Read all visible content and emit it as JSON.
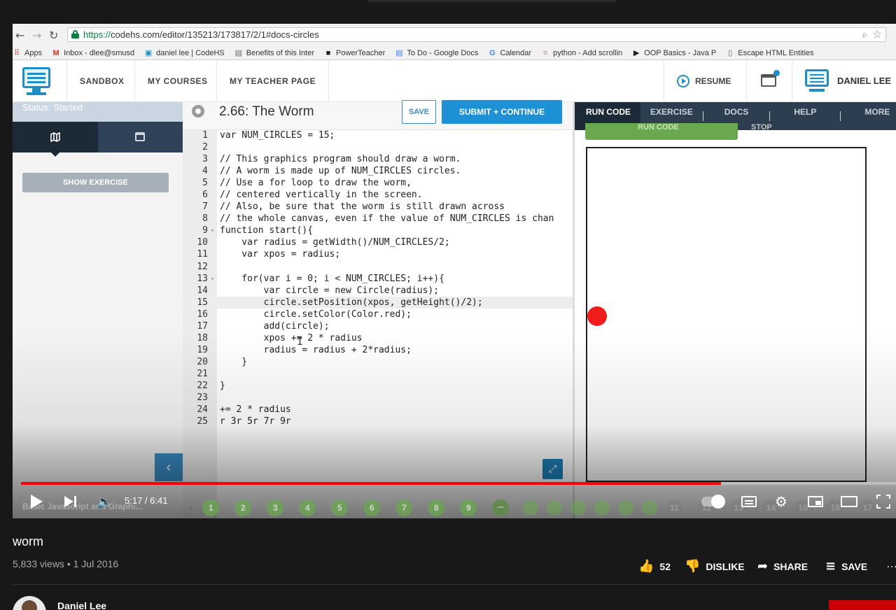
{
  "browser": {
    "url_scheme": "https://",
    "url_rest": "codehs.com/editor/135213/173817/2/1#docs-circles",
    "bookmarks": [
      {
        "label": "Apps",
        "icon": "apps-grid-icon"
      },
      {
        "label": "Inbox - dlee@smusd",
        "icon": "gmail-icon"
      },
      {
        "label": "daniel lee | CodeHS",
        "icon": "codehs-icon"
      },
      {
        "label": "Benefits of this Inter",
        "icon": "page-icon"
      },
      {
        "label": "PowerTeacher",
        "icon": "powerteacher-icon"
      },
      {
        "label": "To Do - Google Docs",
        "icon": "docs-icon"
      },
      {
        "label": "Calendar",
        "icon": "google-icon"
      },
      {
        "label": "python - Add scrollin",
        "icon": "stackoverflow-icon"
      },
      {
        "label": "OOP Basics - Java P",
        "icon": "terminal-icon"
      },
      {
        "label": "Escape HTML Entities",
        "icon": "document-icon"
      }
    ]
  },
  "codehs_nav": {
    "links": [
      "SANDBOX",
      "MY COURSES",
      "MY TEACHER PAGE"
    ],
    "resume": "RESUME",
    "user_name": "DANIEL LEE"
  },
  "sidebar": {
    "status": "Status: Started",
    "show_exercise": "SHOW EXERCISE"
  },
  "editor": {
    "title": "2.66: The Worm",
    "save": "SAVE",
    "submit": "SUBMIT + CONTINUE",
    "highlighted_line": 15,
    "lines": [
      "var NUM_CIRCLES = 15;",
      "",
      "// This graphics program should draw a worm.",
      "// A worm is made up of NUM_CIRCLES circles.",
      "// Use a for loop to draw the worm,",
      "// centered vertically in the screen.",
      "// Also, be sure that the worm is still drawn across",
      "// the whole canvas, even if the value of NUM_CIRCLES is chan",
      "function start(){",
      "    var radius = getWidth()/NUM_CIRCLES/2;",
      "    var xpos = radius;",
      "",
      "    for(var i = 0; i < NUM_CIRCLES; i++){",
      "        var circle = new Circle(radius);",
      "        circle.setPosition(xpos, getHeight()/2);",
      "        circle.setColor(Color.red);",
      "        add(circle);",
      "        xpos += 2 * radius",
      "        radius = radius + 2*radius;",
      "    }",
      "",
      "}",
      "",
      "+= 2 * radius",
      "r 3r 5r 7r 9r"
    ]
  },
  "right_panel": {
    "tabs": [
      "RUN CODE",
      "EXERCISE",
      "DOCS",
      "HELP",
      "MORE"
    ],
    "run_button": "RUN CODE",
    "stop_button": "STOP",
    "circle_color": "#f01c1c"
  },
  "player": {
    "time": "5:17 / 6:41",
    "progress": 0.8,
    "course_title": "Basic Javascript and Graphi...",
    "slides": [
      "1",
      "2",
      "3",
      "4",
      "5",
      "6",
      "7",
      "8",
      "9"
    ],
    "dim_slides": [
      "11",
      "12",
      "13",
      "14",
      "15",
      "16",
      "17"
    ]
  },
  "video_info": {
    "title": "worm",
    "meta": "5,833 views • 1 Jul 2016",
    "likes": "52",
    "dislike": "DISLIKE",
    "share": "SHARE",
    "save": "SAVE",
    "channel": "Daniel Lee"
  }
}
